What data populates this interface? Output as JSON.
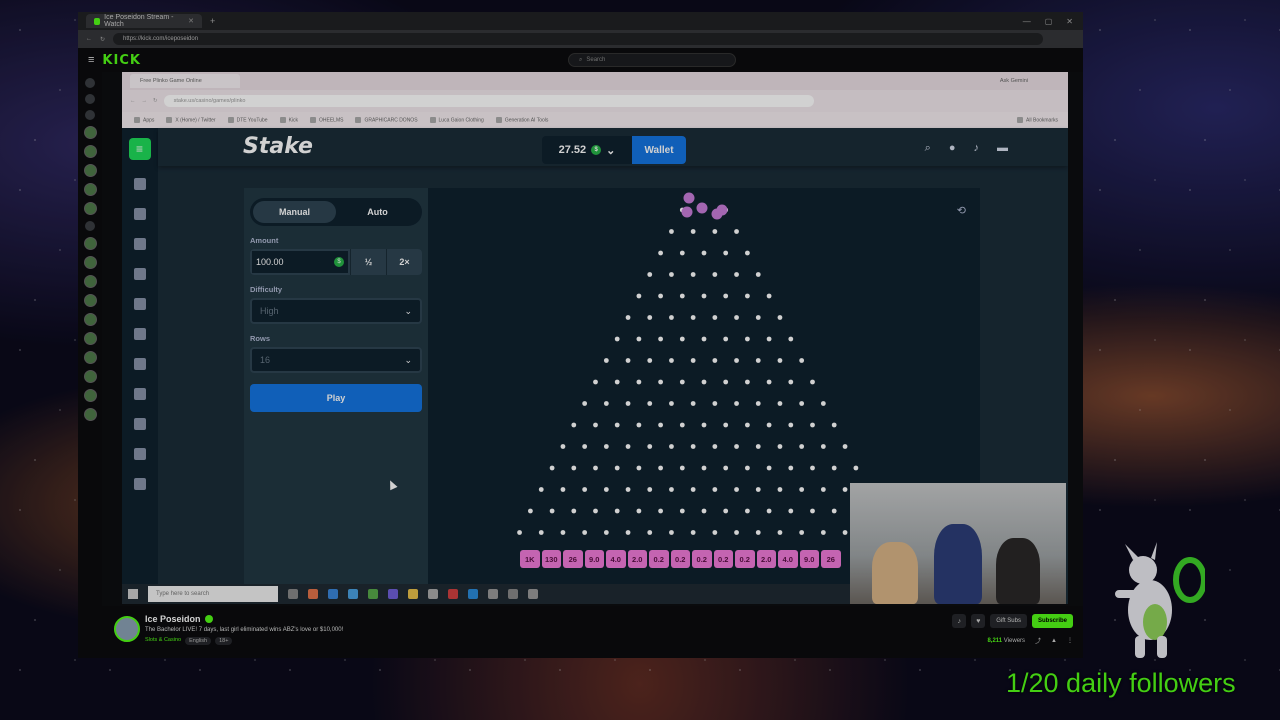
{
  "browser": {
    "tab_title": "Ice Poseidon Stream - Watch",
    "url": "https://kick.com/iceposeidon"
  },
  "kick": {
    "logo": "KICK",
    "search_placeholder": "Search"
  },
  "inner_browser": {
    "tab_title": "Free Plinko Game Online",
    "url": "stake.us/casino/games/plinko",
    "ask": "Ask Gemini",
    "bookmarks": [
      "Apps",
      "X (Home) / Twitter",
      "DTE YouTube",
      "Kick",
      "OHEELMS",
      "GRAPHICARC DONOS",
      "Luca Gaion Clothing",
      "Generation AI Tools"
    ],
    "all_bookmarks": "All Bookmarks"
  },
  "stake": {
    "logo": "Stake",
    "balance": "27.52",
    "coin_symbol": "$",
    "wallet_label": "Wallet",
    "tabs": [
      "Manual",
      "Auto"
    ],
    "amount_label": "Amount",
    "amount_value": "100.00",
    "half_label": "½",
    "double_label": "2×",
    "difficulty_label": "Difficulty",
    "difficulty_value": "High",
    "rows_label": "Rows",
    "rows_value": "16",
    "play_label": "Play",
    "multipliers": [
      "1K",
      "130",
      "26",
      "9.0",
      "4.0",
      "2.0",
      "0.2",
      "0.2",
      "0.2",
      "0.2",
      "0.2",
      "2.0",
      "4.0",
      "9.0",
      "26"
    ],
    "colors": {
      "accent": "#1475e1",
      "panel": "#213743",
      "board": "#0f212e",
      "mult": "#f07bd8",
      "ball": "#c77dd8"
    }
  },
  "taskbar": {
    "search_placeholder": "Type here to search"
  },
  "stream_info": {
    "streamer": "Ice Poseidon",
    "title": "The Bachelor LIVE! 7 days, last girl eliminated wins ABZ's love or $10,000!",
    "category": "Slots & Casino",
    "tags": [
      "English",
      "18+"
    ],
    "gift_label": "Gift Subs",
    "subscribe_label": "Subscribe",
    "viewers": "8,211",
    "viewers_label": "Viewers"
  },
  "overlay": {
    "followers_text": "1/20 daily followers"
  }
}
